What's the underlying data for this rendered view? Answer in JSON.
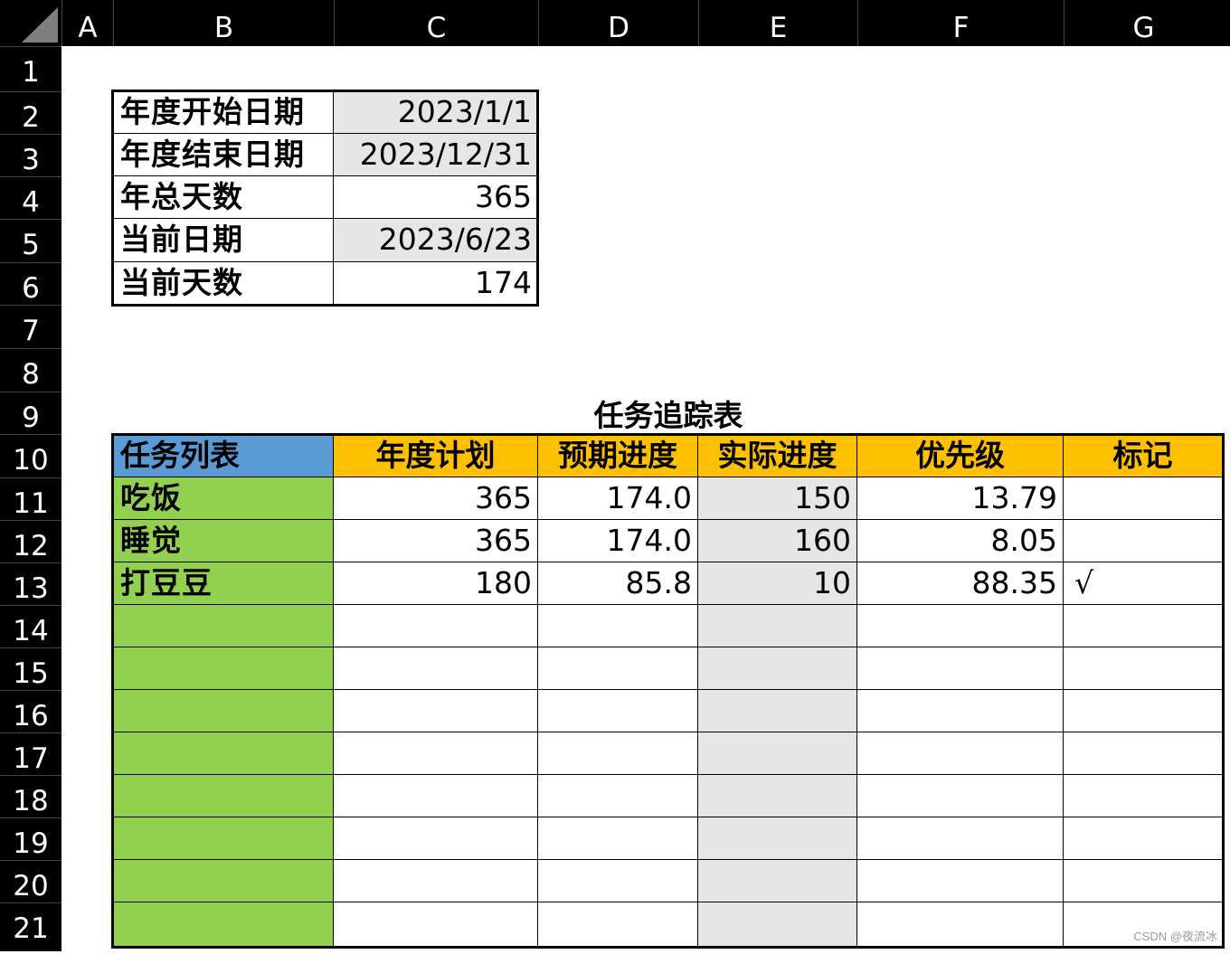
{
  "columns": [
    "A",
    "B",
    "C",
    "D",
    "E",
    "F",
    "G"
  ],
  "rows": [
    "1",
    "2",
    "3",
    "4",
    "5",
    "6",
    "7",
    "8",
    "9",
    "10",
    "11",
    "12",
    "13",
    "14",
    "15",
    "16",
    "17",
    "18",
    "19",
    "20",
    "21"
  ],
  "info": [
    {
      "label": "年度开始日期",
      "value": "2023/1/1"
    },
    {
      "label": "年度结束日期",
      "value": "2023/12/31"
    },
    {
      "label": "年总天数",
      "value": "365"
    },
    {
      "label": "当前日期",
      "value": "2023/6/23"
    },
    {
      "label": "当前天数",
      "value": "174"
    }
  ],
  "tracker": {
    "title": "任务追踪表",
    "headers": [
      "任务列表",
      "年度计划",
      "预期进度",
      "实际进度",
      "优先级",
      "标记"
    ],
    "rows": [
      [
        "吃饭",
        "365",
        "174.0",
        "150",
        "13.79",
        ""
      ],
      [
        "睡觉",
        "365",
        "174.0",
        "160",
        "8.05",
        ""
      ],
      [
        "打豆豆",
        "180",
        "85.8",
        "10",
        "88.35",
        "√"
      ],
      [
        "",
        "",
        "",
        "",
        "",
        ""
      ],
      [
        "",
        "",
        "",
        "",
        "",
        ""
      ],
      [
        "",
        "",
        "",
        "",
        "",
        ""
      ],
      [
        "",
        "",
        "",
        "",
        "",
        ""
      ],
      [
        "",
        "",
        "",
        "",
        "",
        ""
      ],
      [
        "",
        "",
        "",
        "",
        "",
        ""
      ],
      [
        "",
        "",
        "",
        "",
        "",
        ""
      ],
      [
        "",
        "",
        "",
        "",
        "",
        ""
      ]
    ]
  },
  "watermark": "CSDN @夜流冰",
  "colors": {
    "header_bar": "#000000",
    "gray_fill": "#e6e6e6",
    "green_fill": "#92d050",
    "blue_fill": "#5b9bd5",
    "orange_fill": "#ffc000"
  }
}
